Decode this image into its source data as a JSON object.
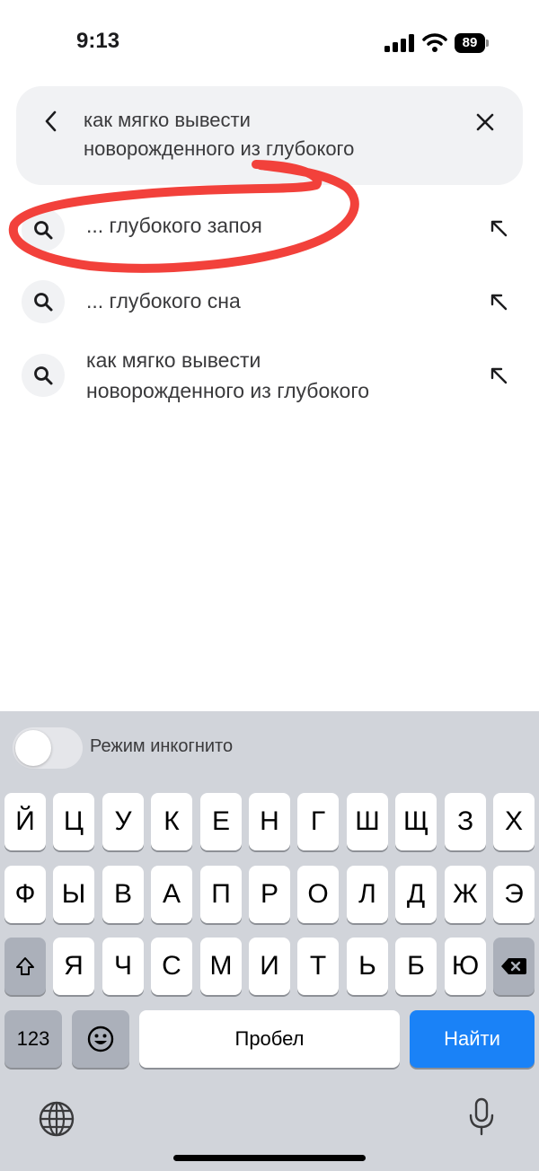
{
  "status": {
    "time": "9:13",
    "battery": "89"
  },
  "search": {
    "query_line1": "как мягко вывести",
    "query_line2": "новорожденного из глубокого"
  },
  "suggestions": [
    {
      "text": "... глубокого запоя"
    },
    {
      "text": "... глубокого сна"
    },
    {
      "line1": "как мягко вывести",
      "line2": "новорожденного из глубокого"
    }
  ],
  "keyboard": {
    "incognito_label": "Режим инкогнито",
    "row1": [
      "Й",
      "Ц",
      "У",
      "К",
      "Е",
      "Н",
      "Г",
      "Ш",
      "Щ",
      "З",
      "Х"
    ],
    "row2": [
      "Ф",
      "Ы",
      "В",
      "А",
      "П",
      "Р",
      "О",
      "Л",
      "Д",
      "Ж",
      "Э"
    ],
    "row3": [
      "Я",
      "Ч",
      "С",
      "М",
      "И",
      "Т",
      "Ь",
      "Б",
      "Ю"
    ],
    "numbers_key": "123",
    "space_key": "Пробел",
    "go_key": "Найти"
  },
  "colors": {
    "accent": "#1a82f7",
    "annotation": "#f2413b",
    "keyboard_bg": "#d1d4da"
  }
}
